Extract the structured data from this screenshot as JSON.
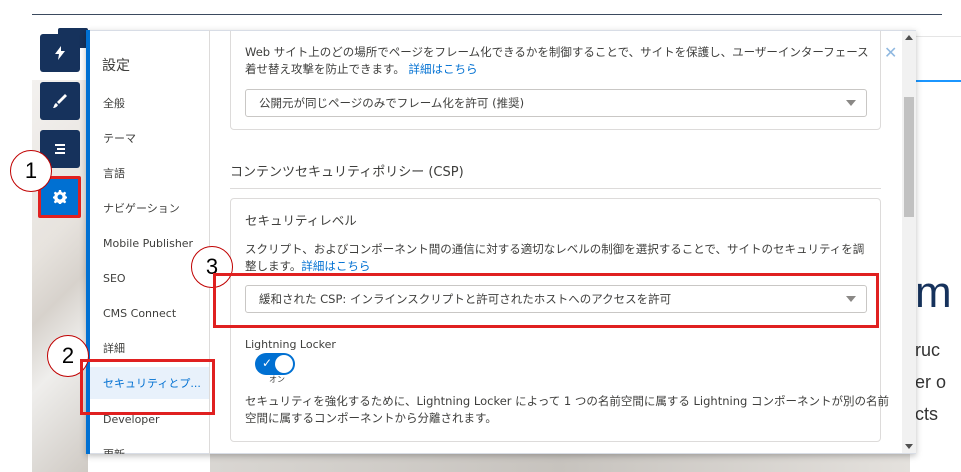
{
  "background": {
    "big_text": "m",
    "lines": [
      "ruc",
      "er o",
      "cts"
    ]
  },
  "toolbar": {
    "items": [
      {
        "icon": "lightning-icon"
      },
      {
        "icon": "brush-icon"
      },
      {
        "icon": "list-icon"
      },
      {
        "icon": "gear-icon",
        "active": true
      }
    ]
  },
  "callouts": [
    "1",
    "2",
    "3"
  ],
  "nav": {
    "title": "設定",
    "items": [
      {
        "label": "全般"
      },
      {
        "label": "テーマ"
      },
      {
        "label": "言語"
      },
      {
        "label": "ナビゲーション"
      },
      {
        "label": "Mobile Publisher"
      },
      {
        "label": "SEO"
      },
      {
        "label": "CMS Connect"
      },
      {
        "label": "詳細"
      },
      {
        "label": "セキュリティとプ...",
        "selected": true
      },
      {
        "label": "Developer"
      },
      {
        "label": "更新"
      }
    ]
  },
  "clickjack": {
    "line1": "Web サイト上のどの場所でページをフレーム化できるかを制御することで、サイトを保護し、ユーザーインターフェース",
    "line2": "着せ替え攻撃を防止できます。",
    "link": "詳細はこちら",
    "select_value": "公開元が同じページのみでフレーム化を許可 (推奨)"
  },
  "csp": {
    "section_title": "コンテンツセキュリティポリシー (CSP)",
    "level_title": "セキュリティレベル",
    "desc1": "スクリプト、およびコンポーネント間の通信に対する適切なレベルの制御を選択することで、サイトのセキュリティを調",
    "desc2": "整します。",
    "link": "詳細はこちら",
    "select_value": "緩和された CSP: インラインスクリプトと許可されたホストへのアクセスを許可",
    "locker_label": "Lightning Locker",
    "toggle_state": "オン",
    "toggle_on": true,
    "locker_desc1": "セキュリティを強化するために、Lightning Locker によって 1 つの名前空間に属する Lightning コンポーネントが別の名前",
    "locker_desc2": "空間に属するコンポーネントから分離されます。"
  },
  "colors": {
    "accent": "#0070d2",
    "navy": "#16325c",
    "highlight": "#e02020"
  }
}
